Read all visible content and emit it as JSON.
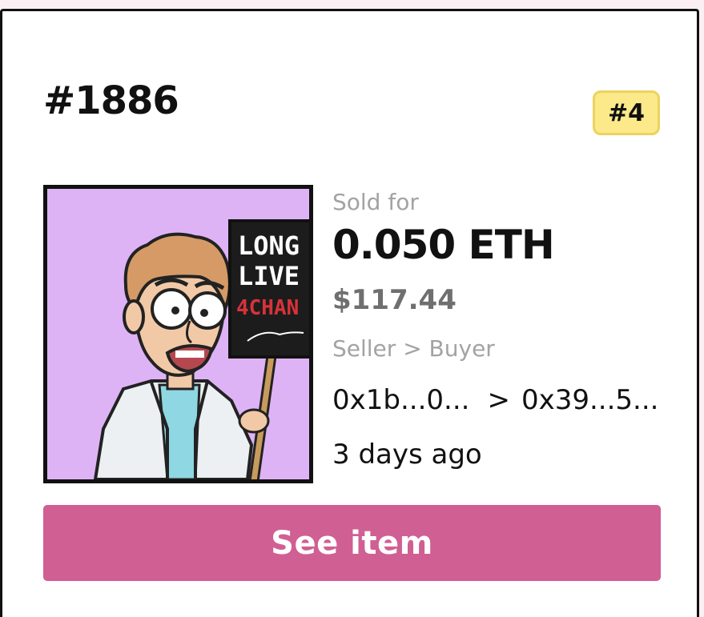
{
  "card": {
    "title": "#1886",
    "rank_badge": "#4",
    "sale": {
      "sold_label": "Sold for",
      "price_eth": "0.050 ETH",
      "price_usd": "$117.44",
      "party_label": "Seller > Buyer",
      "seller": "0x1b...0...",
      "separator": ">",
      "buyer": "0x39...5...",
      "time_ago": "3 days ago"
    },
    "artwork": {
      "sign_lines": [
        "LONG",
        "LIVE",
        "4CHAN"
      ]
    },
    "button_label": "See item"
  },
  "colors": {
    "page_background": "#fbeff4",
    "card_border": "#111111",
    "badge_fill": "#fbe98a",
    "badge_border": "#ecd35e",
    "art_background": "#deb3f5",
    "muted_text": "#a3a3a3",
    "usd_text": "#6f6f6f",
    "button": "#d05f94"
  }
}
